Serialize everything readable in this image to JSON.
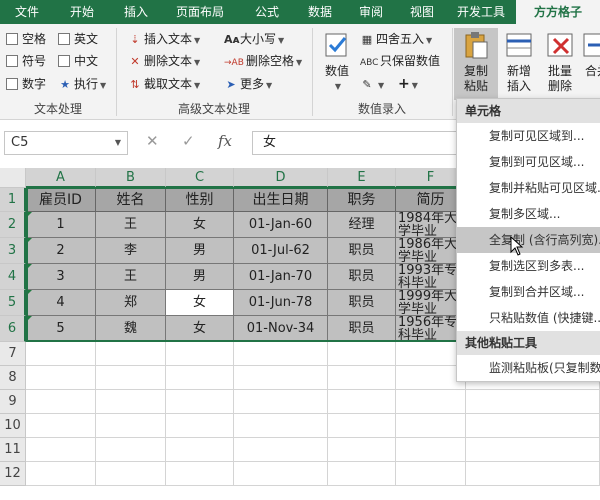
{
  "tabs": [
    "文件",
    "开始",
    "插入",
    "页面布局",
    "公式",
    "数据",
    "审阅",
    "视图",
    "开发工具",
    "方方格子"
  ],
  "active_tab_index": 9,
  "ribbon": {
    "text_processing": {
      "checkboxes": [
        "空格",
        "英文",
        "符号",
        "中文",
        "数字"
      ],
      "execute_label": "执行",
      "group_label": "文本处理"
    },
    "advanced_text": {
      "items": [
        "插入文本",
        "删除文本",
        "截取文本",
        "大小写",
        "删除空格",
        "更多"
      ],
      "group_label": "高级文本处理"
    },
    "numeric_entry": {
      "value_label": "数值",
      "round_label": "四舍五入",
      "keep_value_label": "只保留数值",
      "group_label": "数值录入"
    },
    "copy_paste_label": "复制粘贴",
    "add_insert_label": "新增插入",
    "batch_delete_label": "批量删除",
    "merge_label": "合并"
  },
  "formula_bar": {
    "name_box": "C5",
    "content": "女",
    "fx_label": "fx"
  },
  "columns": [
    "A",
    "B",
    "C",
    "D",
    "E",
    "F"
  ],
  "rows": [
    "1",
    "2",
    "3",
    "4",
    "5",
    "6",
    "7",
    "8",
    "9",
    "10",
    "11",
    "12"
  ],
  "table": {
    "headers": [
      "雇员ID",
      "姓名",
      "性别",
      "出生日期",
      "职务",
      "简历"
    ],
    "rows": [
      [
        "1",
        "王",
        "女",
        "01-Jan-60",
        "经理",
        "1984年大学毕业"
      ],
      [
        "2",
        "李",
        "男",
        "01-Jul-62",
        "职员",
        "1986年大学毕业"
      ],
      [
        "3",
        "王",
        "男",
        "01-Jan-70",
        "职员",
        "1993年专科毕业"
      ],
      [
        "4",
        "郑",
        "女",
        "01-Jun-78",
        "职员",
        "1999年大学毕业"
      ],
      [
        "5",
        "魏",
        "女",
        "01-Nov-34",
        "职员",
        "1956年专科毕业"
      ]
    ]
  },
  "context_menu": {
    "section1": "单元格",
    "items1": [
      "复制可见区域到...",
      "复制到可见区域...",
      "复制并粘贴可见区域...",
      "复制多区域...",
      "全复制 (含行高列宽)...",
      "复制选区到多表...",
      "复制到合并区域...",
      "只粘贴数值 (快捷键..."
    ],
    "highlighted_index": 4,
    "section2": "其他粘贴工具",
    "items2": [
      "监测粘贴板(只复制数..."
    ]
  },
  "colors": {
    "excel_green": "#217346",
    "cell_gray": "#c0c0c0",
    "header_gray": "#a6a6a6"
  }
}
